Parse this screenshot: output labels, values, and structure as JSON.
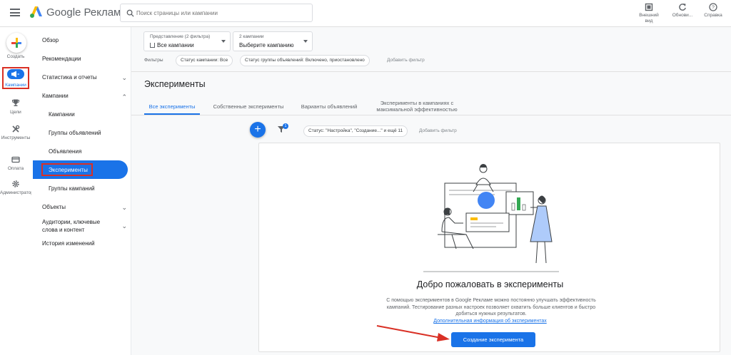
{
  "header": {
    "brand": "Google Реклама",
    "search_placeholder": "Поиск страницы или кампании",
    "appearance": "Внешний вид",
    "refresh": "Обнови...",
    "help": "Справка"
  },
  "rail": {
    "create": "Создать",
    "campaigns": "Кампании",
    "goals": "Цели",
    "tools": "Инструменты",
    "billing": "Оплата",
    "admin": "Администратор"
  },
  "nav": {
    "overview": "Обзор",
    "recommendations": "Рекомендации",
    "stats": "Статистика и отчеты",
    "campaigns_group": "Кампании",
    "campaigns": "Кампании",
    "ad_groups": "Группы объявлений",
    "ads": "Объявления",
    "experiments": "Эксперименты",
    "campaign_groups": "Группы кампаний",
    "assets": "Объекты",
    "audiences": "Аудитории, ключевые слова и контент",
    "change_history": "История изменений"
  },
  "view_selector": {
    "label": "Представление (2 фильтра)",
    "value": "Все кампании"
  },
  "campaign_selector": {
    "label": "2 кампании",
    "value": "Выберите кампанию"
  },
  "filters": {
    "label": "Фильтры",
    "chip1": "Статус кампании: Все",
    "chip2": "Статус группы объявлений: Включено, приостановлено",
    "add": "Добавить фильтр"
  },
  "page": {
    "title": "Эксперименты",
    "tabs": {
      "all": "Все эксперименты",
      "custom": "Собственные эксперименты",
      "ad_variants": "Варианты объявлений",
      "pmax": "Эксперименты в кампаниях с максимальной эффективностью"
    },
    "filter_badge": "1",
    "status_chip": "Статус: \"Настройка\", \"Создание...\" и ещё 11",
    "add_filter": "Добавить фильтр"
  },
  "empty_state": {
    "title": "Добро пожаловать в эксперименты",
    "description": "С помощью экспериментов в Google Рекламе можно постоянно улучшать эффективность кампаний. Тестирование разных настроек позволяет охватить больше клиентов и быстро добиться нужных результатов.",
    "link": "Дополнительная информация об экспериментах",
    "button": "Создание эксперимента"
  },
  "colors": {
    "accent": "#1a73e8",
    "highlight": "#d93025"
  }
}
